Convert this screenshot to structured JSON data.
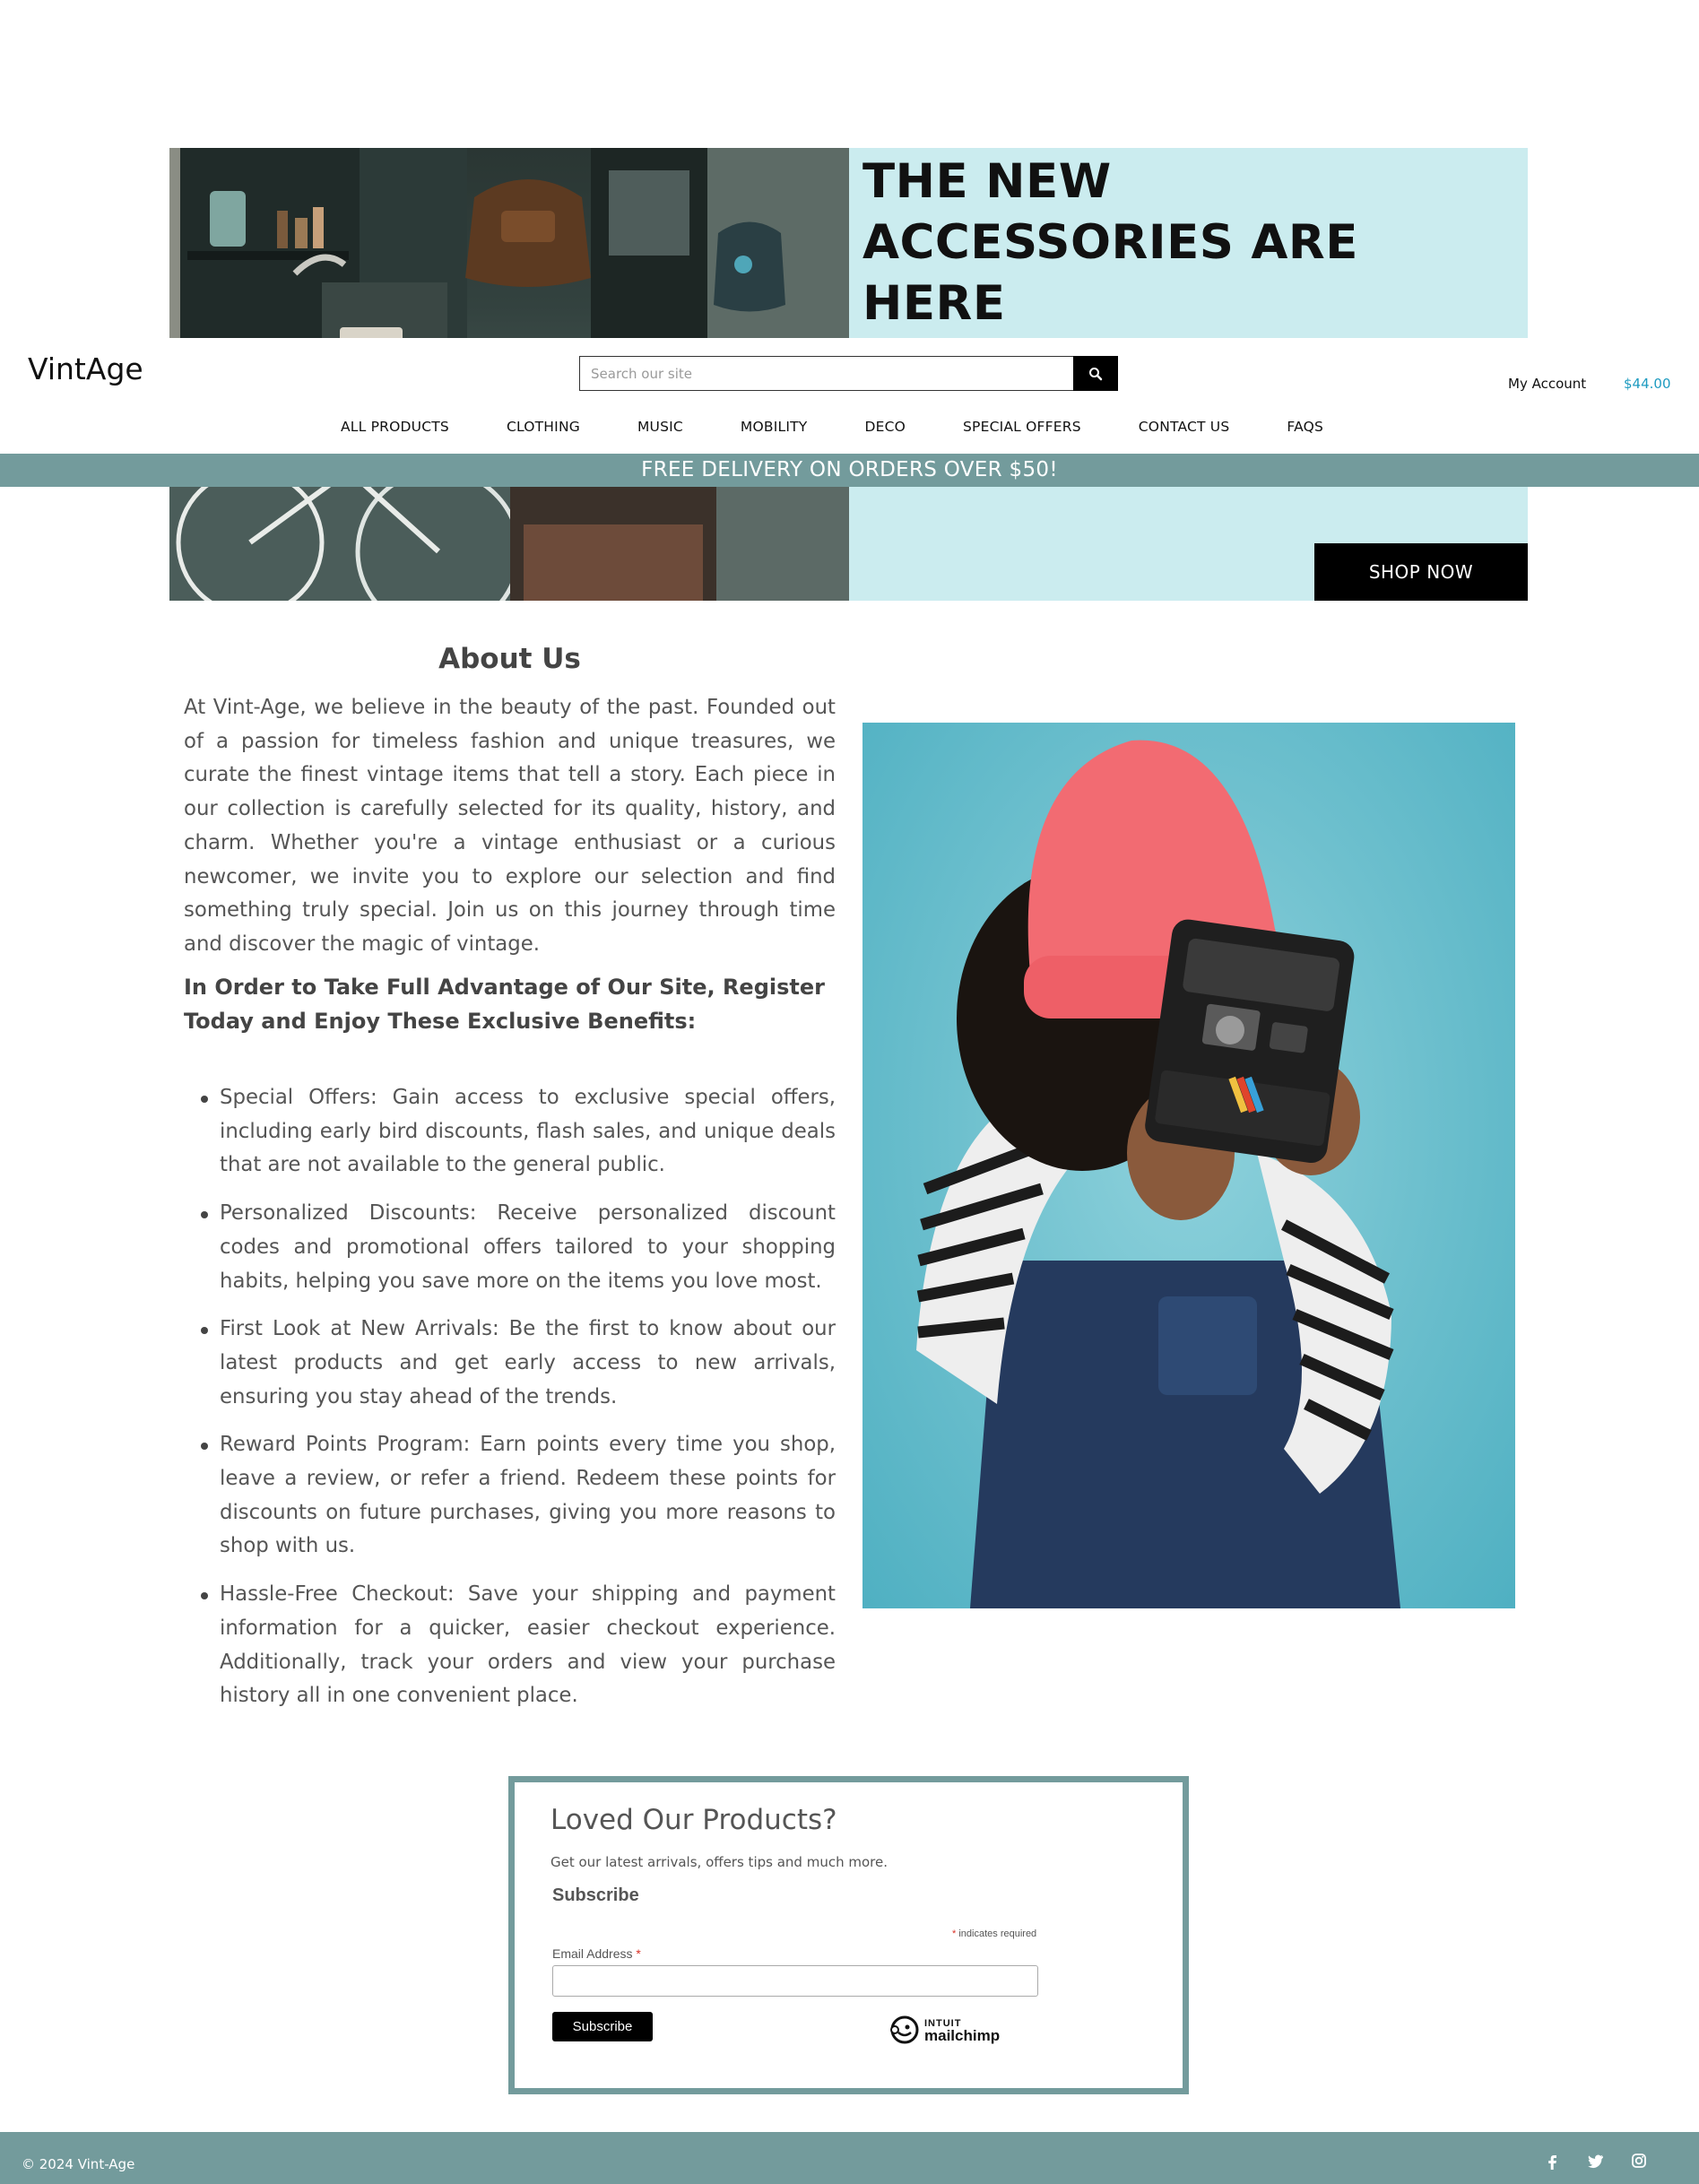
{
  "hero": {
    "headline": "THE NEW ACCESSORIES ARE HERE",
    "cta_label": "SHOP NOW"
  },
  "header": {
    "logo": "VintAge",
    "search_placeholder": "Search our site",
    "account_label": "My Account",
    "cart_total": "$44.00"
  },
  "nav": {
    "items": [
      "ALL PRODUCTS",
      "CLOTHING",
      "MUSIC",
      "MOBILITY",
      "DECO",
      "SPECIAL OFFERS",
      "CONTACT US",
      "FAQS"
    ]
  },
  "banner": {
    "delivery_text": "FREE DELIVERY ON ORDERS OVER $50!"
  },
  "about": {
    "title": "About Us",
    "text": "At Vint-Age, we believe in the beauty of the past. Founded out of a passion for timeless fashion and unique treasures, we curate the finest vintage items that tell a story. Each piece in our collection is carefully selected for its quality, history, and charm. Whether you're a vintage enthusiast or a curious newcomer, we invite you to explore our selection and find something truly special. Join us on this journey through time and discover the magic of vintage.",
    "benefits_heading": "In Order to Take Full Advantage of Our Site, Register Today and Enjoy These Exclusive Benefits:",
    "benefits": [
      "Special Offers: Gain access to exclusive special offers, including early bird discounts, flash sales, and unique deals that are not available to the general public.",
      "Personalized Discounts: Receive personalized discount codes and promotional offers tailored to your shopping habits, helping you save more on the items you love most.",
      "First Look at New Arrivals: Be the first to know about our latest products and get early access to new arrivals, ensuring you stay ahead of the trends.",
      "Reward Points Program: Earn points every time you shop, leave a review, or refer a friend. Redeem these points for discounts on future purchases, giving you more reasons to shop with us.",
      "Hassle-Free Checkout: Save your shipping and payment information for a quicker, easier checkout experience. Additionally, track your orders and view your purchase history all in one convenient place."
    ]
  },
  "newsletter": {
    "title": "Loved Our Products?",
    "subtitle": "Get our latest arrivals, offers tips and much more.",
    "form_heading": "Subscribe",
    "required_star": "*",
    "required_note": "indicates required",
    "email_label": "Email Address",
    "email_value": "",
    "button_label": "Subscribe",
    "brand_top": "INTUIT",
    "brand_bottom": "mailchimp"
  },
  "footer": {
    "copyright": "© 2024 Vint-Age",
    "social_icons": [
      "facebook-icon",
      "twitter-icon",
      "instagram-icon"
    ]
  },
  "colors": {
    "accent_teal": "#739b9c",
    "hero_bg": "#cbecef",
    "price_blue": "#1e9bc0",
    "photo_bg": "#6ec0ce",
    "beanie_pink": "#f26b72"
  }
}
